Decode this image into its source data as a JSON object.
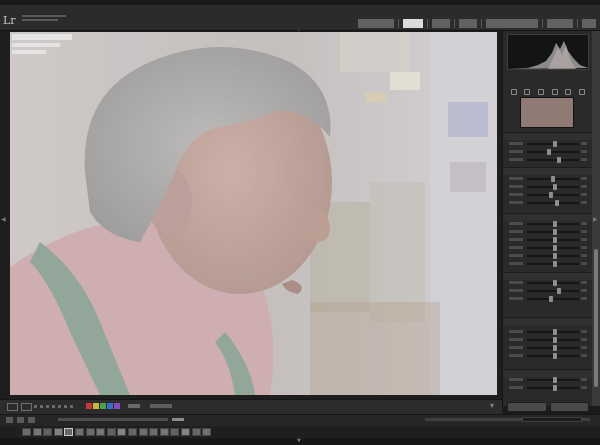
{
  "app": {
    "logo": "Lr"
  },
  "photo": {
    "description_icon": "portrait-photo",
    "dominant_colors": [
      "#b9b6b6",
      "#c8a6a8",
      "#7d8b80",
      "#a39087"
    ]
  },
  "toolbar": {
    "color_labels": [
      "#c23a3a",
      "#c9b83a",
      "#4aa24a",
      "#3a6ec2",
      "#8a4ac2"
    ]
  },
  "colors": {
    "background": "#1b1b1b",
    "panel": "#2a2a2a",
    "active_module": "#dcdcdc",
    "swatch": "#8f7b73"
  }
}
